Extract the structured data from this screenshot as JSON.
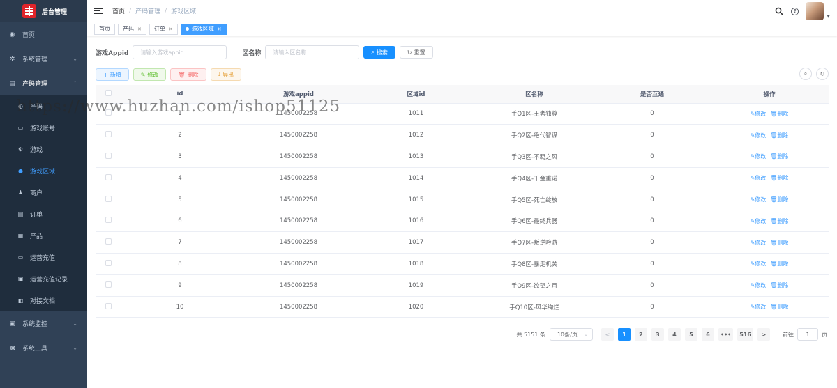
{
  "brand": {
    "title": "后台管理",
    "color": "#e0242b"
  },
  "sidebar": {
    "menu_top": [
      {
        "label": "首页",
        "icon": "dashboard-icon",
        "glyph": "◉"
      },
      {
        "label": "系统管理",
        "icon": "gear-icon",
        "glyph": "✲",
        "arrow": "⌄"
      },
      {
        "label": "产码管理",
        "icon": "document-icon",
        "glyph": "▤",
        "arrow": "⌃"
      }
    ],
    "sub_items": [
      {
        "label": "产码",
        "glyph": "◐"
      },
      {
        "label": "游戏账号",
        "glyph": "▭"
      },
      {
        "label": "游戏",
        "glyph": "⚙"
      },
      {
        "label": "游戏区域",
        "glyph": "●"
      },
      {
        "label": "商户",
        "glyph": "♟"
      },
      {
        "label": "订单",
        "glyph": "▤"
      },
      {
        "label": "产品",
        "glyph": "▦"
      },
      {
        "label": "运营充值",
        "glyph": "▭"
      },
      {
        "label": "运营充值记录",
        "glyph": "▣"
      },
      {
        "label": "对接文档",
        "glyph": "◧"
      }
    ],
    "menu_bottom": [
      {
        "label": "系统监控",
        "glyph": "▣",
        "arrow": "⌄"
      },
      {
        "label": "系统工具",
        "glyph": "▩",
        "arrow": "⌄"
      }
    ]
  },
  "header": {
    "breadcrumb": [
      "首页",
      "产码管理",
      "游戏区域"
    ],
    "separator": "/"
  },
  "tags": [
    {
      "label": "首页",
      "closable": false
    },
    {
      "label": "产码",
      "closable": true
    },
    {
      "label": "订单",
      "closable": true
    },
    {
      "label": "游戏区域",
      "closable": true,
      "active": true
    }
  ],
  "search": {
    "appid_label": "游戏Appid",
    "appid_placeholder": "请输入游戏appid",
    "name_label": "区名称",
    "name_placeholder": "请输入区名称",
    "search_btn": "搜索",
    "reset_btn": "重置"
  },
  "toolbar": {
    "add": "新增",
    "edit": "修改",
    "delete": "删除",
    "export": "导出"
  },
  "table": {
    "headers": [
      "id",
      "游戏appid",
      "区域id",
      "区名称",
      "是否互通",
      "操作"
    ],
    "edit_label": "修改",
    "delete_label": "删除",
    "rows": [
      {
        "id": "1",
        "appid": "1450002258",
        "area_id": "1011",
        "name": "手Q1区-王者独尊",
        "interop": "0"
      },
      {
        "id": "2",
        "appid": "1450002258",
        "area_id": "1012",
        "name": "手Q2区-绝代智谋",
        "interop": "0"
      },
      {
        "id": "3",
        "appid": "1450002258",
        "area_id": "1013",
        "name": "手Q3区-不羁之风",
        "interop": "0"
      },
      {
        "id": "4",
        "appid": "1450002258",
        "area_id": "1014",
        "name": "手Q4区-千金重诺",
        "interop": "0"
      },
      {
        "id": "5",
        "appid": "1450002258",
        "area_id": "1015",
        "name": "手Q5区-死亡绽放",
        "interop": "0"
      },
      {
        "id": "6",
        "appid": "1450002258",
        "area_id": "1016",
        "name": "手Q6区-最终兵器",
        "interop": "0"
      },
      {
        "id": "7",
        "appid": "1450002258",
        "area_id": "1017",
        "name": "手Q7区-叛逆吟游",
        "interop": "0"
      },
      {
        "id": "8",
        "appid": "1450002258",
        "area_id": "1018",
        "name": "手Q8区-暴走机关",
        "interop": "0"
      },
      {
        "id": "9",
        "appid": "1450002258",
        "area_id": "1019",
        "name": "手Q9区-欲望之月",
        "interop": "0"
      },
      {
        "id": "10",
        "appid": "1450002258",
        "area_id": "1020",
        "name": "手Q10区-风华绚烂",
        "interop": "0"
      }
    ]
  },
  "pagination": {
    "total": "共 5151 条",
    "page_size": "10条/页",
    "prev": "<",
    "pages": [
      "1",
      "2",
      "3",
      "4",
      "5",
      "6"
    ],
    "ellipsis": "•••",
    "last": "516",
    "next": ">",
    "goto_label": "前往",
    "goto_value": "1",
    "goto_suffix": "页"
  },
  "watermark": "https://www.huzhan.com/ishop51125",
  "colors": {
    "primary": "#1890ff",
    "sidebar_bg": "#304156",
    "active_text": "#409eff"
  }
}
